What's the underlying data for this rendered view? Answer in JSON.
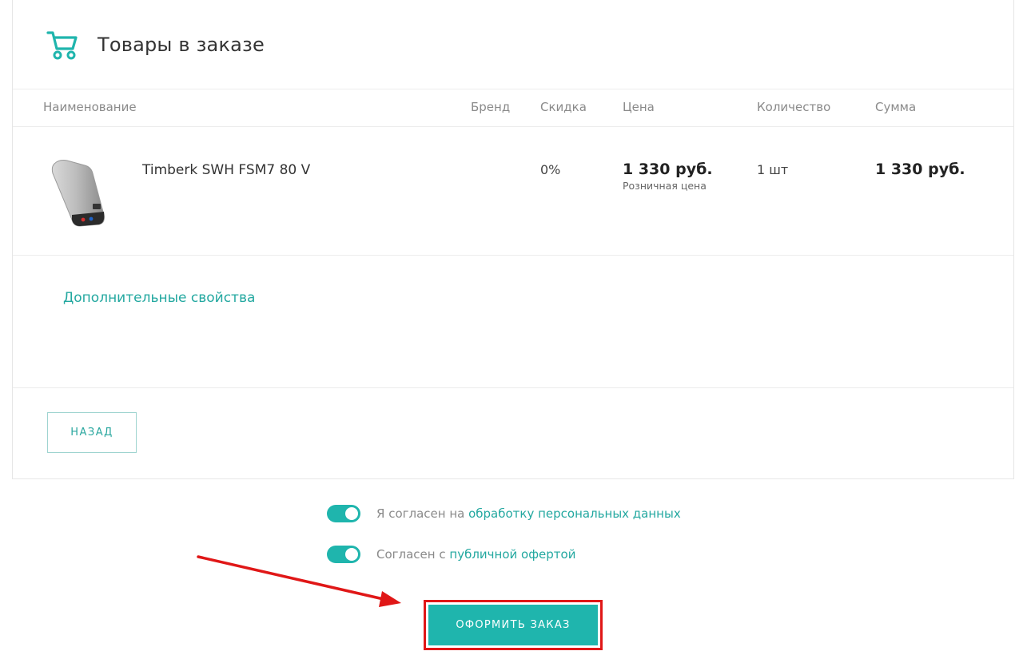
{
  "panel": {
    "title": "Товары в заказе",
    "cart_icon": "shopping-cart-icon",
    "accent_color": "#1fb5ad"
  },
  "table": {
    "headers": {
      "name": "Наименование",
      "brand": "Бренд",
      "discount": "Скидка",
      "price": "Цена",
      "quantity": "Количество",
      "sum": "Сумма"
    },
    "rows": [
      {
        "name": "Timberk SWH FSM7 80 V",
        "brand": "",
        "discount": "0%",
        "price": "1 330 руб.",
        "price_note": "Розничная цена",
        "quantity": "1 шт",
        "sum": "1 330 руб."
      }
    ]
  },
  "extra": {
    "link_label": "Дополнительные свойства"
  },
  "actions": {
    "back_label": "НАЗАД",
    "order_label": "ОФОРМИТЬ ЗАКАЗ"
  },
  "consents": [
    {
      "checked": true,
      "prefix": "Я согласен на ",
      "link": "обработку персональных данных"
    },
    {
      "checked": true,
      "prefix": "Согласен с ",
      "link": "публичной офертой"
    }
  ],
  "annotation": {
    "highlight_color": "#e01717"
  }
}
